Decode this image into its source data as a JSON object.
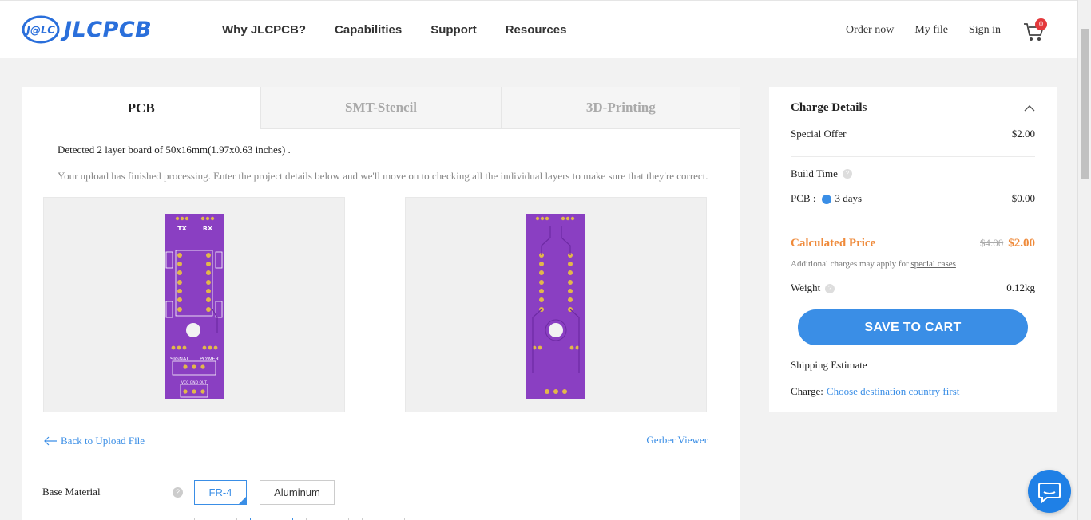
{
  "header": {
    "logo_text": "JLCPCB",
    "nav": [
      "Why JLCPCB?",
      "Capabilities",
      "Support",
      "Resources"
    ],
    "right_nav": [
      "Order now",
      "My file",
      "Sign in"
    ],
    "cart_count": "0"
  },
  "main": {
    "tabs": [
      {
        "label": "PCB",
        "active": true
      },
      {
        "label": "SMT-Stencil",
        "active": false
      },
      {
        "label": "3D-Printing",
        "active": false
      }
    ],
    "detect_text": "Detected 2 layer board of 50x16mm(1.97x0.63 inches) .",
    "processing_text": "Your upload has finished processing. Enter the project details below and we'll move on to checking all the individual layers to make sure that they're correct.",
    "back_link": "Back to Upload File",
    "gerber_link": "Gerber Viewer",
    "base_material": {
      "label": "Base Material",
      "options": [
        "FR-4",
        "Aluminum"
      ],
      "selected": "FR-4"
    },
    "board_labels": {
      "tx": "TX",
      "rx": "RX",
      "signal": "SIGNAL",
      "power": "POWER",
      "pins": "VCC GND OUT"
    }
  },
  "charge": {
    "title": "Charge Details",
    "special_offer_label": "Special Offer",
    "special_offer_value": "$2.00",
    "build_time_label": "Build Time",
    "pcb_label": "PCB :",
    "pcb_days": "3 days",
    "pcb_value": "$0.00",
    "calc_label": "Calculated Price",
    "old_price": "$4.00",
    "new_price": "$2.00",
    "note_prefix": "Additional charges may apply for",
    "note_link": "special cases",
    "weight_label": "Weight",
    "weight_value": "0.12kg",
    "save_button": "SAVE TO CART",
    "shipping_label": "Shipping Estimate",
    "charge_label": "Charge:",
    "charge_link": "Choose destination country first"
  },
  "colors": {
    "accent": "#3a8ee6",
    "orange": "#ef8a3a",
    "board": "#8a3fc2"
  }
}
